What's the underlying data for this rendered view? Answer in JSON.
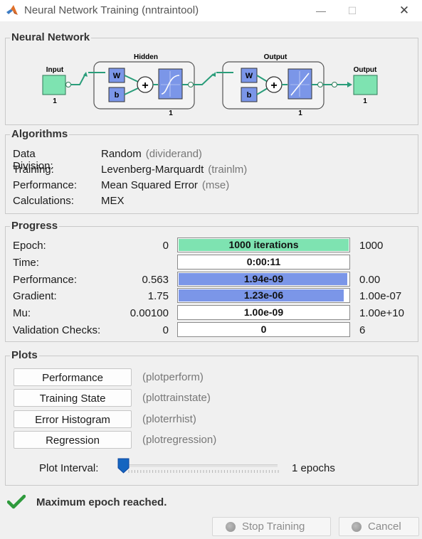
{
  "window": {
    "title": "Neural Network Training (nntraintool)",
    "minimize_glyph": "—",
    "maximize_glyph": "☐",
    "close_glyph": "✕",
    "icon": "matlab-logo-icon"
  },
  "network": {
    "section_title": "Neural Network",
    "input_label": "Input",
    "input_size": "1",
    "hidden_label": "Hidden",
    "hidden_size": "1",
    "output_layer_label": "Output",
    "output_layer_size": "1",
    "output_label": "Output",
    "output_size": "1",
    "weight_symbol": "W",
    "bias_symbol": "b",
    "sum_symbol": "+"
  },
  "algorithms": {
    "section_title": "Algorithms",
    "rows": [
      {
        "label": "Data Division:",
        "value": "Random",
        "fn": "(dividerand)"
      },
      {
        "label": "Training:",
        "value": "Levenberg-Marquardt",
        "fn": "(trainlm)"
      },
      {
        "label": "Performance:",
        "value": "Mean Squared Error",
        "fn": "(mse)"
      },
      {
        "label": "Calculations:",
        "value": "MEX",
        "fn": ""
      }
    ]
  },
  "progress": {
    "section_title": "Progress",
    "rows": [
      {
        "label": "Epoch:",
        "start": "0",
        "current": "1000 iterations",
        "end": "1000",
        "fill_fraction": 1.0,
        "color": "green"
      },
      {
        "label": "Time:",
        "start": "",
        "current": "0:00:11",
        "end": "",
        "fill_fraction": 0,
        "color": "none"
      },
      {
        "label": "Performance:",
        "start": "0.563",
        "current": "1.94e-09",
        "end": "0.00",
        "fill_fraction": 0.99,
        "color": "blue"
      },
      {
        "label": "Gradient:",
        "start": "1.75",
        "current": "1.23e-06",
        "end": "1.00e-07",
        "fill_fraction": 0.97,
        "color": "blue"
      },
      {
        "label": "Mu:",
        "start": "0.00100",
        "current": "1.00e-09",
        "end": "1.00e+10",
        "fill_fraction": 0,
        "color": "none"
      },
      {
        "label": "Validation Checks:",
        "start": "0",
        "current": "0",
        "end": "6",
        "fill_fraction": 0,
        "color": "none"
      }
    ],
    "colors": {
      "green": "#7ee3b1",
      "blue": "#7b96e8"
    }
  },
  "plots": {
    "section_title": "Plots",
    "buttons": [
      {
        "label": "Performance",
        "fn": "(plotperform)"
      },
      {
        "label": "Training State",
        "fn": "(plottrainstate)"
      },
      {
        "label": "Error Histogram",
        "fn": "(ploterrhist)"
      },
      {
        "label": "Regression",
        "fn": "(plotregression)"
      }
    ],
    "interval_label": "Plot Interval:",
    "interval_value": "1 epochs",
    "interval_slider_fraction": 0.0
  },
  "status": {
    "icon": "checkmark-icon",
    "message": "Maximum epoch reached."
  },
  "actions": {
    "stop_label": "Stop Training",
    "cancel_label": "Cancel"
  }
}
